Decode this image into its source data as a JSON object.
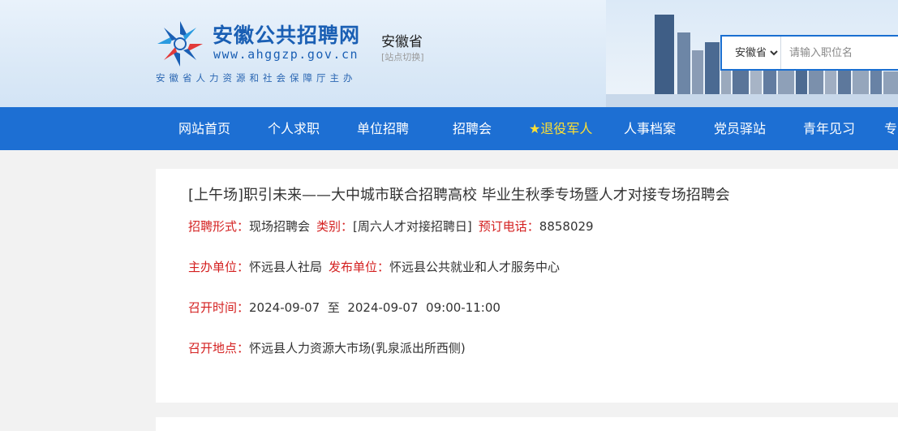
{
  "header": {
    "title": "安徽公共招聘网",
    "url": "www.ahggzp.gov.cn",
    "region": "安徽省",
    "switch_label": "[站点切换]",
    "subtitle": "安徽省人力资源和社会保障厅主办"
  },
  "search": {
    "selected_region": "安徽省",
    "placeholder": "请输入职位名"
  },
  "nav": {
    "items": [
      "网站首页",
      "个人求职",
      "单位招聘",
      "招聘会",
      "★退役军人",
      "人事档案",
      "党员驿站",
      "青年见习",
      "专"
    ]
  },
  "event": {
    "title": "[上午场]职引未来——大中城市联合招聘高校 毕业生秋季专场暨人才对接专场招聘会",
    "form_label": "招聘形式：",
    "form_value": "现场招聘会",
    "category_label": "类别：",
    "category_value": "[周六人才对接招聘日]",
    "phone_label": "预订电话：",
    "phone_value": "8858029",
    "host_label": "主办单位：",
    "host_value": "怀远县人社局",
    "publisher_label": "发布单位：",
    "publisher_value": "怀远县公共就业和人才服务中心",
    "time_label": "召开时间：",
    "start_date": "2024-09-07",
    "to_word": "至",
    "end_date": "2024-09-07",
    "hours": "09:00-11:00",
    "location_label": "召开地点：",
    "location_value": "怀远县人力资源大市场(乳泉派出所西侧)"
  },
  "colors": {
    "brand_blue": "#1d6fd3",
    "label_red": "#d42020",
    "nav_special": "#ffe033"
  }
}
